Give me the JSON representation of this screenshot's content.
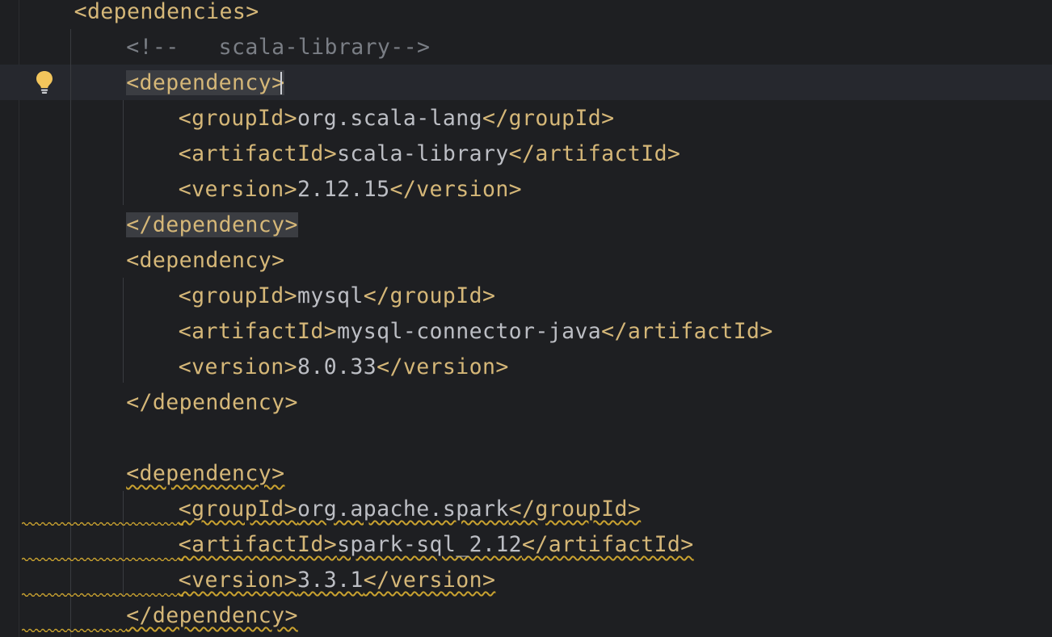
{
  "editor": {
    "lines": [
      {
        "indent": 2,
        "parts": [
          {
            "t": "tag",
            "v": "<dependencies>"
          }
        ]
      },
      {
        "indent": 4,
        "parts": [
          {
            "t": "cmt",
            "v": "<!--   scala-library-->"
          }
        ]
      },
      {
        "indent": 4,
        "caret": true,
        "parts": [
          {
            "t": "tag",
            "v": "<dependency>",
            "match": true
          }
        ]
      },
      {
        "indent": 6,
        "parts": [
          {
            "t": "tag",
            "v": "<groupId>"
          },
          {
            "t": "txt",
            "v": "org.scala-lang"
          },
          {
            "t": "tag",
            "v": "</groupId>"
          }
        ]
      },
      {
        "indent": 6,
        "parts": [
          {
            "t": "tag",
            "v": "<artifactId>"
          },
          {
            "t": "txt",
            "v": "scala-library"
          },
          {
            "t": "tag",
            "v": "</artifactId>"
          }
        ]
      },
      {
        "indent": 6,
        "parts": [
          {
            "t": "tag",
            "v": "<version>"
          },
          {
            "t": "txt",
            "v": "2.12.15"
          },
          {
            "t": "tag",
            "v": "</version>"
          }
        ]
      },
      {
        "indent": 4,
        "parts": [
          {
            "t": "tag",
            "v": "</dependency>",
            "match": true
          }
        ]
      },
      {
        "indent": 4,
        "parts": [
          {
            "t": "tag",
            "v": "<dependency>"
          }
        ]
      },
      {
        "indent": 6,
        "parts": [
          {
            "t": "tag",
            "v": "<groupId>"
          },
          {
            "t": "txt",
            "v": "mysql"
          },
          {
            "t": "tag",
            "v": "</groupId>"
          }
        ]
      },
      {
        "indent": 6,
        "parts": [
          {
            "t": "tag",
            "v": "<artifactId>"
          },
          {
            "t": "txt",
            "v": "mysql-connector-java"
          },
          {
            "t": "tag",
            "v": "</artifactId>"
          }
        ]
      },
      {
        "indent": 6,
        "parts": [
          {
            "t": "tag",
            "v": "<version>"
          },
          {
            "t": "txt",
            "v": "8.0.33"
          },
          {
            "t": "tag",
            "v": "</version>"
          }
        ]
      },
      {
        "indent": 4,
        "parts": [
          {
            "t": "tag",
            "v": "</dependency>"
          }
        ]
      },
      {
        "indent": 0,
        "parts": []
      },
      {
        "indent": 4,
        "warn": true,
        "parts": [
          {
            "t": "tag",
            "v": "<dependency>"
          }
        ]
      },
      {
        "indent": 6,
        "warn": true,
        "parts": [
          {
            "t": "tag",
            "v": "<groupId>"
          },
          {
            "t": "txt",
            "v": "org.apache.spark"
          },
          {
            "t": "tag",
            "v": "</groupId>"
          }
        ]
      },
      {
        "indent": 6,
        "warn": true,
        "parts": [
          {
            "t": "tag",
            "v": "<artifactId>"
          },
          {
            "t": "txt",
            "v": "spark-sql_2.12"
          },
          {
            "t": "tag",
            "v": "</artifactId>"
          }
        ]
      },
      {
        "indent": 6,
        "warn": true,
        "parts": [
          {
            "t": "tag",
            "v": "<version>"
          },
          {
            "t": "txt",
            "v": "3.3.1"
          },
          {
            "t": "tag",
            "v": "</version>"
          }
        ]
      },
      {
        "indent": 4,
        "warn": true,
        "parts": [
          {
            "t": "tag",
            "v": "</dependency>"
          }
        ]
      }
    ]
  },
  "gutter": {
    "intention_icon": "lightbulb-icon"
  },
  "colors": {
    "background": "#1e1f22",
    "tag": "#d5b778",
    "text": "#bcbec4",
    "comment": "#7a7e85",
    "warning": "#c9a230",
    "current_line": "#26282e"
  }
}
